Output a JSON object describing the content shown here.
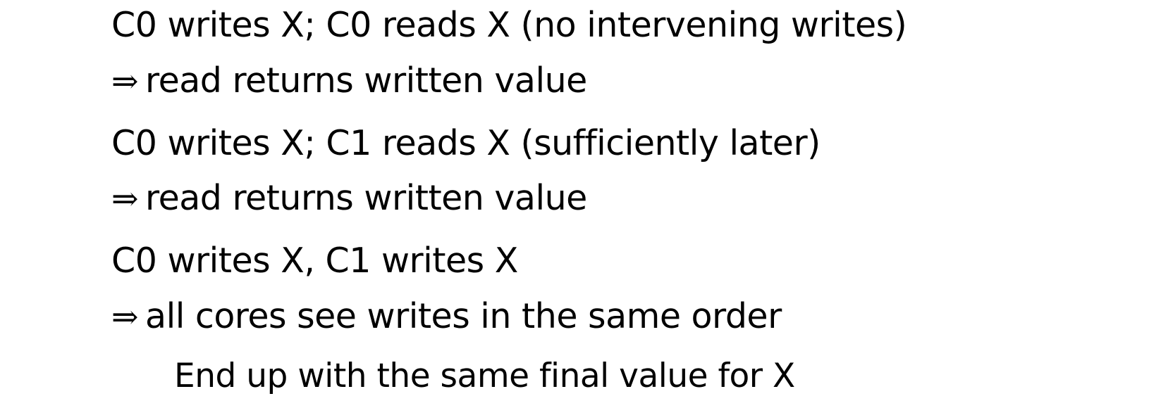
{
  "rules": [
    {
      "condition": "C0 writes X; C0 reads X (no intervening writes)",
      "arrow": "⇒",
      "result": "read returns written value"
    },
    {
      "condition": "C0 writes X; C1 reads X (sufficiently later)",
      "arrow": "⇒",
      "result": "read returns written value"
    },
    {
      "condition": "C0 writes X, C1 writes X",
      "arrow": "⇒",
      "result": "all cores see writes in the same order",
      "detail": "End up with the same final value for X"
    }
  ]
}
